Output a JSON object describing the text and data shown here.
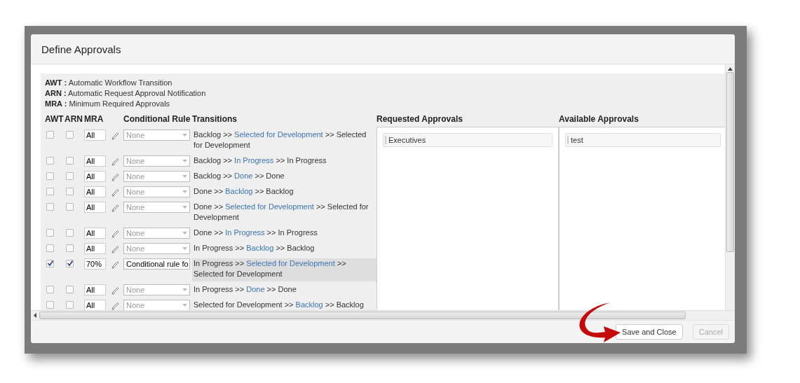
{
  "dialog": {
    "title": "Define Approvals"
  },
  "legend": [
    {
      "abbr": "AWT :",
      "text": "Automatic Workflow Transition"
    },
    {
      "abbr": "ARN :",
      "text": "Automatic Request Approval Notification"
    },
    {
      "abbr": "MRA :",
      "text": "Minimum Required Approvals"
    }
  ],
  "columns": [
    "AWT",
    "ARN",
    "MRA",
    "Conditional Rule",
    "Transitions"
  ],
  "rows": [
    {
      "awt": false,
      "arn": false,
      "mra": "All",
      "rule": "None",
      "rule_disabled": true,
      "from": "Backlog >>",
      "via": "Selected for Development",
      "to": ">> Selected for Development",
      "selected": false
    },
    {
      "awt": false,
      "arn": false,
      "mra": "All",
      "rule": "None",
      "rule_disabled": true,
      "from": "Backlog >>",
      "via": "In Progress",
      "to": ">> In Progress",
      "selected": false
    },
    {
      "awt": false,
      "arn": false,
      "mra": "All",
      "rule": "None",
      "rule_disabled": true,
      "from": "Backlog >>",
      "via": "Done",
      "to": ">> Done",
      "selected": false
    },
    {
      "awt": false,
      "arn": false,
      "mra": "All",
      "rule": "None",
      "rule_disabled": true,
      "from": "Done >>",
      "via": "Backlog",
      "to": ">> Backlog",
      "selected": false
    },
    {
      "awt": false,
      "arn": false,
      "mra": "All",
      "rule": "None",
      "rule_disabled": true,
      "from": "Done >>",
      "via": "Selected for Development",
      "to": ">> Selected for Development",
      "selected": false
    },
    {
      "awt": false,
      "arn": false,
      "mra": "All",
      "rule": "None",
      "rule_disabled": true,
      "from": "Done >>",
      "via": "In Progress",
      "to": ">> In Progress",
      "selected": false
    },
    {
      "awt": false,
      "arn": false,
      "mra": "All",
      "rule": "None",
      "rule_disabled": true,
      "from": "In Progress >>",
      "via": "Backlog",
      "to": ">> Backlog",
      "selected": false
    },
    {
      "awt": true,
      "arn": true,
      "mra": "70%",
      "rule": "Conditional rule fo",
      "rule_disabled": false,
      "from": "In Progress >>",
      "via": "Selected for Development",
      "to": ">> Selected for Development",
      "selected": true
    },
    {
      "awt": false,
      "arn": false,
      "mra": "All",
      "rule": "None",
      "rule_disabled": true,
      "from": "In Progress >>",
      "via": "Done",
      "to": ">> Done",
      "selected": false
    },
    {
      "awt": false,
      "arn": false,
      "mra": "All",
      "rule": "None",
      "rule_disabled": true,
      "from": "Selected for Development >>",
      "via": "Backlog",
      "to": ">> Backlog",
      "selected": false
    }
  ],
  "requested": {
    "title": "Requested Approvals",
    "items": [
      "Executives"
    ]
  },
  "available": {
    "title": "Available Approvals",
    "items": [
      "test"
    ]
  },
  "buttons": [
    {
      "label": "Save and Close",
      "disabled": false
    },
    {
      "label": "Cancel",
      "disabled": true
    }
  ]
}
